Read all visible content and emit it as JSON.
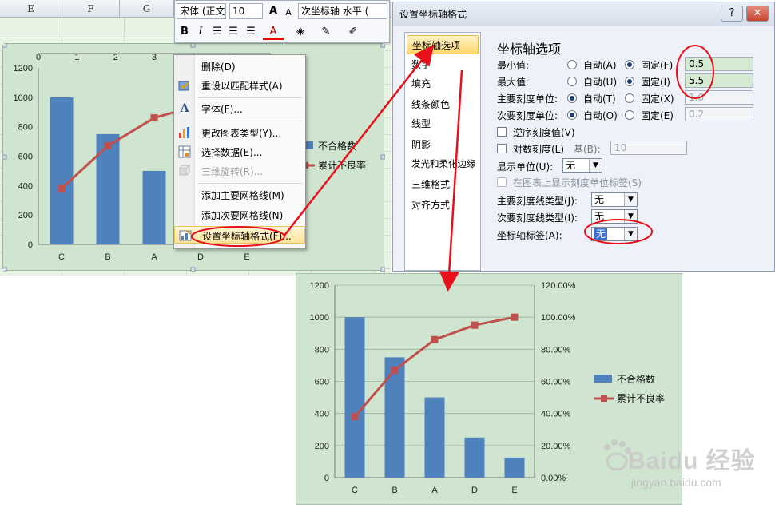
{
  "sheet": {
    "columns": [
      "E",
      "F",
      "G"
    ]
  },
  "mini_toolbar": {
    "font_name": "宋体 (正文",
    "font_size": "10",
    "grow_font": "A",
    "shrink_font": "A",
    "selector": "次坐标轴 水平 (",
    "bold": "B",
    "italic": "I",
    "font_color_letter": "A"
  },
  "context_menu": {
    "items": [
      {
        "label": "删除(D)",
        "icon": "none"
      },
      {
        "label": "重设以匹配样式(A)",
        "icon": "reset-style-icon"
      },
      {
        "label": "字体(F)...",
        "icon": "font-icon"
      },
      {
        "label": "更改图表类型(Y)...",
        "icon": "chart-type-icon"
      },
      {
        "label": "选择数据(E)...",
        "icon": "select-data-icon"
      },
      {
        "label": "三维旋转(R)...",
        "icon": "rotate-3d-icon"
      },
      {
        "label": "添加主要网格线(M)",
        "icon": "none"
      },
      {
        "label": "添加次要网格线(N)",
        "icon": "none"
      },
      {
        "label": "设置坐标轴格式(F)...",
        "icon": "format-axis-icon"
      }
    ]
  },
  "dialog": {
    "title": "设置坐标轴格式",
    "help": "?",
    "close": "✕",
    "nav": [
      "坐标轴选项",
      "数字",
      "填充",
      "线条颜色",
      "线型",
      "阴影",
      "发光和柔化边缘",
      "三维格式",
      "对齐方式"
    ],
    "section_title": "坐标轴选项",
    "rows": [
      {
        "label": "最小值:",
        "auto": "自动(A)",
        "fixed": "固定(F)",
        "value": "0.5",
        "fixed_on": true
      },
      {
        "label": "最大值:",
        "auto": "自动(U)",
        "fixed": "固定(I)",
        "value": "5.5",
        "fixed_on": true
      },
      {
        "label": "主要刻度单位:",
        "auto": "自动(T)",
        "fixed": "固定(X)",
        "value": "1.0",
        "fixed_on": false
      },
      {
        "label": "次要刻度单位:",
        "auto": "自动(O)",
        "fixed": "固定(E)",
        "value": "0.2",
        "fixed_on": false
      }
    ],
    "reverse": "逆序刻度值(V)",
    "log": "对数刻度(L)",
    "base_label": "基(B):",
    "base_value": "10",
    "display_units_label": "显示单位(U):",
    "display_units_value": "无",
    "show_units_label": "在图表上显示刻度单位标签(S)",
    "major_tick_label": "主要刻度线类型(J):",
    "major_tick_value": "无",
    "minor_tick_label": "次要刻度线类型(I):",
    "minor_tick_value": "无",
    "axis_labels_label": "坐标轴标签(A):",
    "axis_labels_value": "无"
  },
  "chart_data": [
    {
      "type": "bar",
      "categories": [
        "C",
        "B",
        "A",
        "D",
        "E"
      ],
      "series": [
        {
          "name": "不合格数",
          "values": [
            1000,
            750,
            500,
            250,
            125
          ]
        },
        {
          "name": "累计不良率",
          "values": [
            38,
            67,
            86,
            95,
            100
          ],
          "type": "line"
        }
      ],
      "ylim": [
        0,
        1200
      ],
      "yticks": [
        "0",
        "200",
        "400",
        "600",
        "800",
        "1000",
        "1200"
      ],
      "secondary_x_ticks": [
        "0",
        "1",
        "2",
        "3",
        "4",
        "5",
        "6"
      ],
      "legend": "right"
    },
    {
      "type": "bar",
      "categories": [
        "C",
        "B",
        "A",
        "D",
        "E"
      ],
      "series": [
        {
          "name": "不合格数",
          "values": [
            1000,
            750,
            500,
            250,
            125
          ]
        },
        {
          "name": "累计不良率",
          "values": [
            38,
            67,
            86,
            95,
            100
          ],
          "type": "line",
          "unit": "%"
        }
      ],
      "ylim": [
        0,
        1200
      ],
      "y2lim": [
        0,
        120
      ],
      "yticks": [
        "0",
        "200",
        "400",
        "600",
        "800",
        "1000",
        "1200"
      ],
      "y2ticks": [
        "0.00%",
        "20.00%",
        "40.00%",
        "60.00%",
        "80.00%",
        "100.00%",
        "120.00%"
      ],
      "legend": "right",
      "grid": true
    }
  ],
  "colors": {
    "bar": "#4f81bd",
    "line": "#c0504d",
    "chart_bg": "#cfe5cf",
    "annotation": "#e8101c"
  },
  "watermark": {
    "brand": "Baidu 经验",
    "url": "jingyan.baidu.com"
  }
}
